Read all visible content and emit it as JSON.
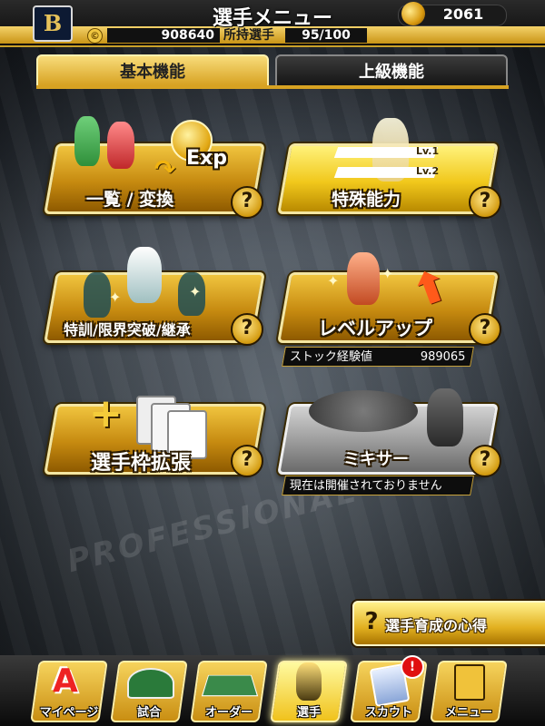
{
  "header": {
    "team_logo": "B",
    "title": "選手メニュー",
    "coins": "2061",
    "money": "908640",
    "owned_label": "所持選手",
    "owned_value": "95/100"
  },
  "tabs": [
    {
      "label": "基本機能",
      "active": true
    },
    {
      "label": "上級機能",
      "active": false
    }
  ],
  "cards": {
    "list_exchange": {
      "label": "一覧 / 変換",
      "exp_text": "Exp"
    },
    "special_ability": {
      "label": "特殊能力",
      "lv1": "Lv.1",
      "lv2": "Lv.2"
    },
    "training": {
      "label": "特訓/限界突破/継承"
    },
    "level_up": {
      "label": "レベルアップ",
      "sub_label": "ストック経験値",
      "sub_value": "989065"
    },
    "expand_slots": {
      "label": "選手枠拡張"
    },
    "mixer": {
      "label": "ミキサー",
      "sub_label": "現在は開催されておりません"
    }
  },
  "help_glyph": "?",
  "background_text": "PROFESSIONAL",
  "tips_button": {
    "label": "選手育成の心得"
  },
  "nav": [
    {
      "label": "マイページ",
      "icon": "a-badge-icon"
    },
    {
      "label": "試合",
      "icon": "stadium-icon"
    },
    {
      "label": "オーダー",
      "icon": "field-order-icon"
    },
    {
      "label": "選手",
      "icon": "player-icon",
      "active": true
    },
    {
      "label": "スカウト",
      "icon": "scout-card-icon",
      "badge": "!"
    },
    {
      "label": "メニュー",
      "icon": "menu-character-icon"
    }
  ],
  "colors": {
    "gold": "#d7a222",
    "active_gold": "#f0c21c",
    "badge_red": "#e01010"
  }
}
